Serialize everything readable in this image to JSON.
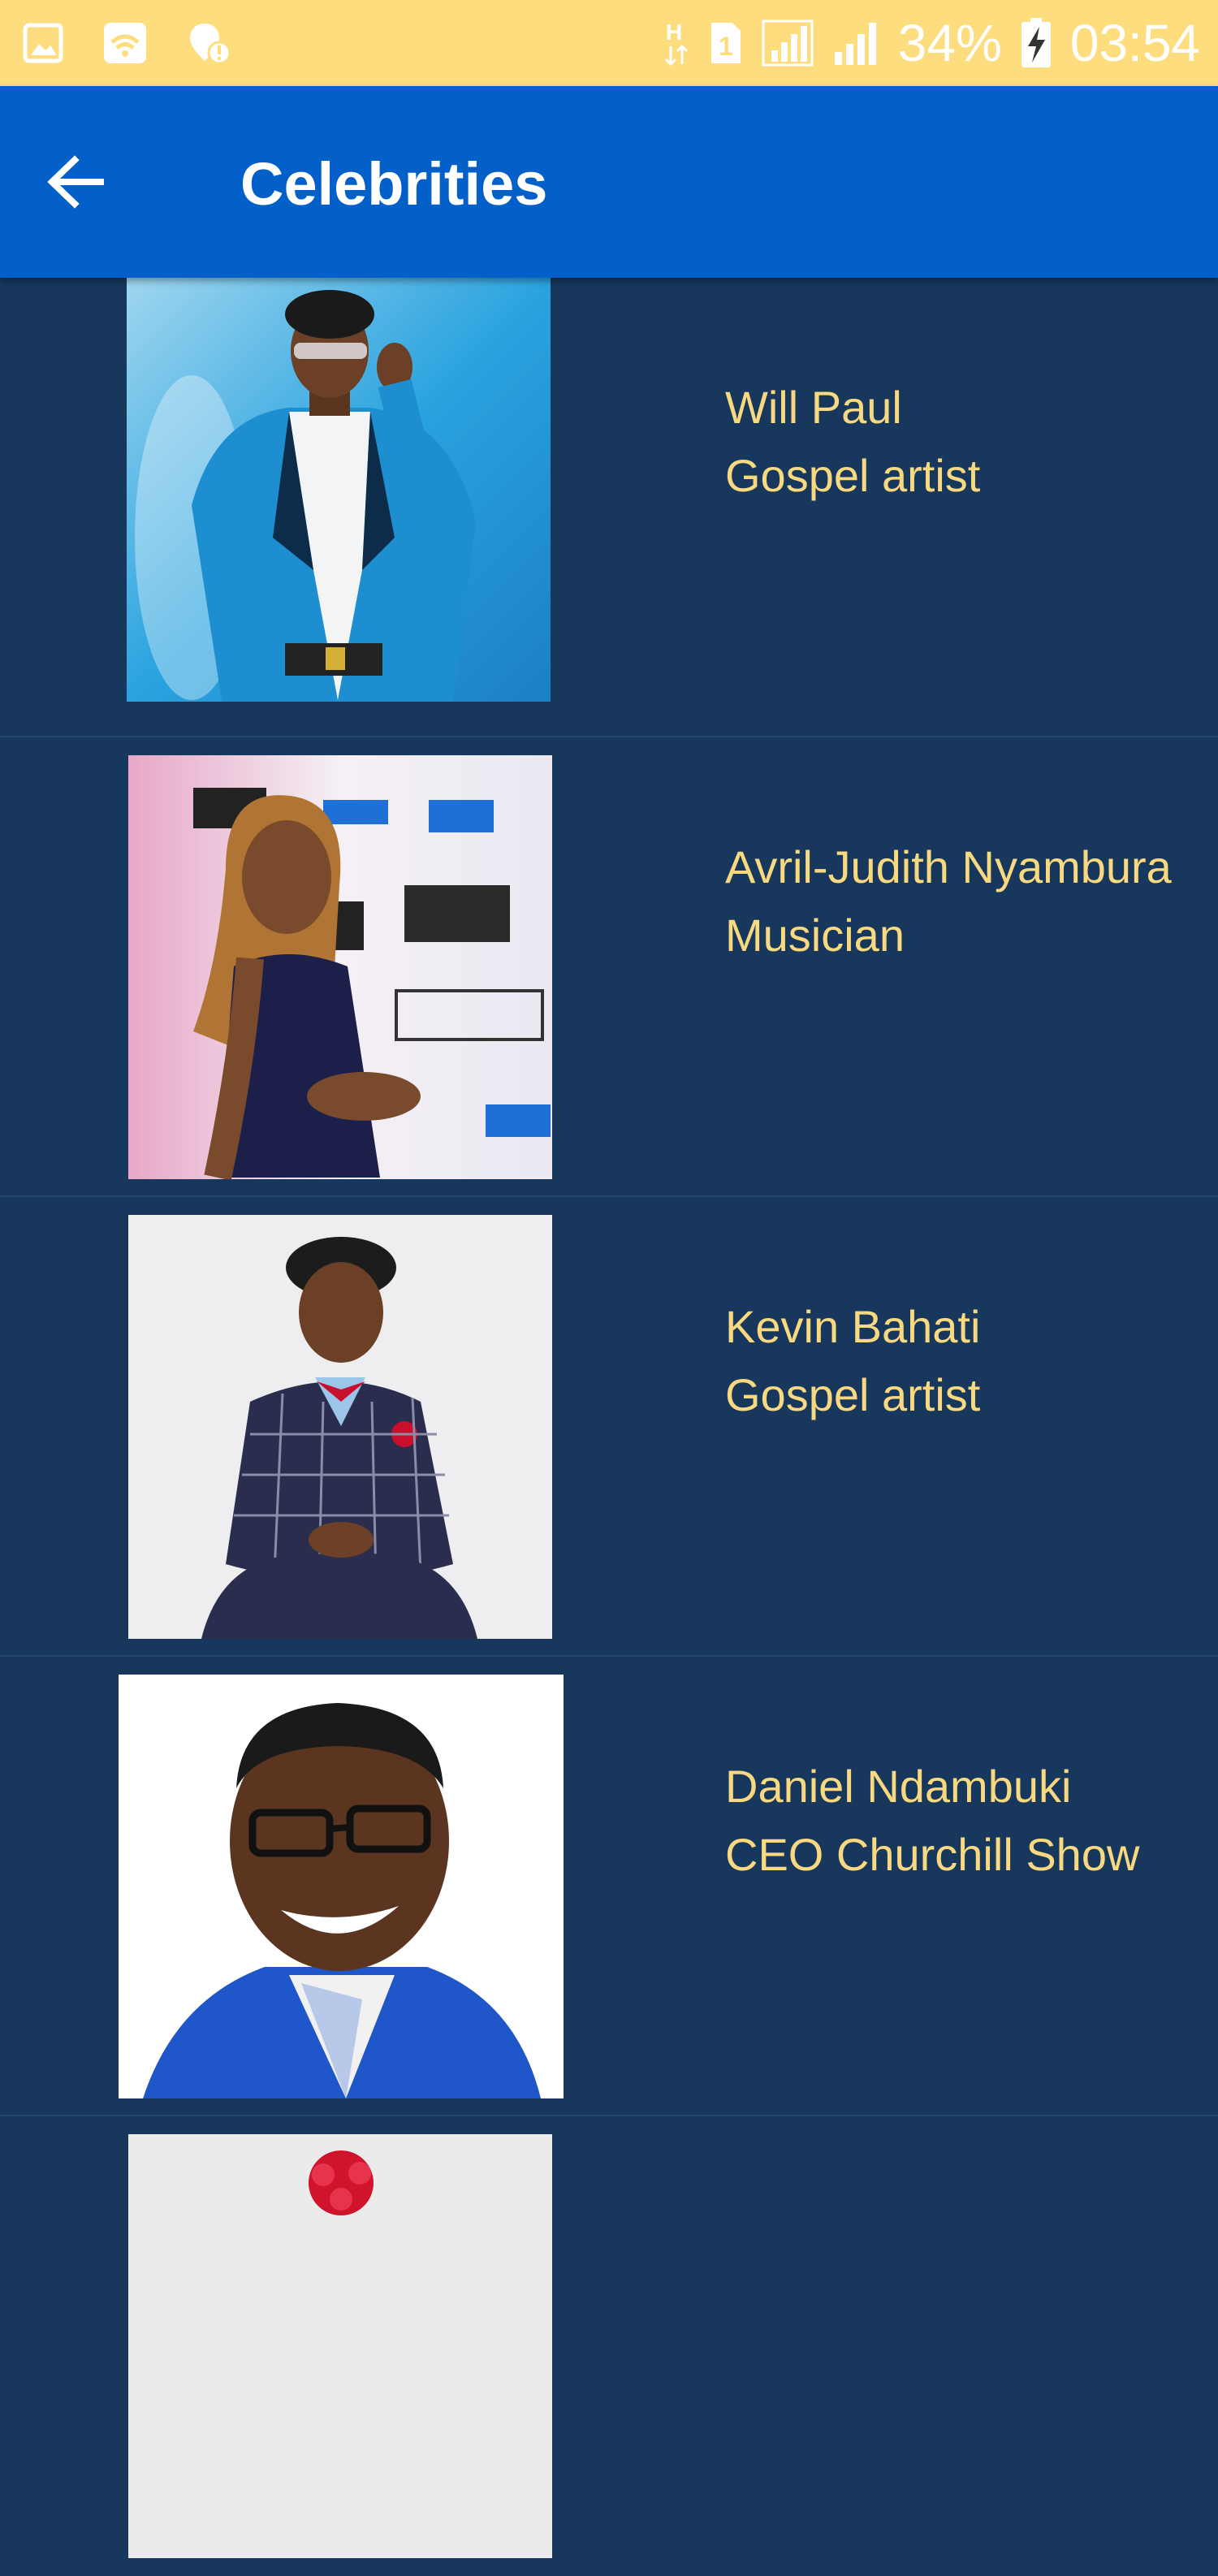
{
  "status_bar": {
    "battery_percent": "34%",
    "time": "03:54",
    "icons": [
      "gallery-icon",
      "wifi-hotspot-icon",
      "location-alert-icon",
      "h-network-icon",
      "sim-1-icon",
      "signal-icon",
      "signal-icon",
      "battery-charging-icon"
    ]
  },
  "app_bar": {
    "title": "Celebrities",
    "back_icon": "arrow-left-icon"
  },
  "colors": {
    "status_bar": "#fddd7d",
    "app_bar": "#0360c8",
    "background": "#17375d",
    "text": "#f8d980"
  },
  "celebrities": [
    {
      "name": "Will Paul",
      "role": "Gospel artist"
    },
    {
      "name": "Avril-Judith Nyambura",
      "role": "Musician"
    },
    {
      "name": "Kevin Bahati",
      "role": "Gospel artist"
    },
    {
      "name": "Daniel Ndambuki",
      "role": "CEO Churchill Show"
    }
  ]
}
